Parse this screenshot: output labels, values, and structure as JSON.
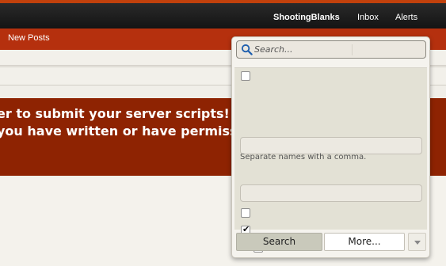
{
  "header": {
    "username": "ShootingBlanks",
    "inbox_label": "Inbox",
    "alerts_label": "Alerts"
  },
  "tabs": {
    "new_posts": "New Posts"
  },
  "banner": {
    "line1": "er to submit your server scripts! Make",
    "line2": "you have written or have permission"
  },
  "search_panel": {
    "search_placeholder": "Search...",
    "hint_text": "Separate names with a comma.",
    "search_button": "Search",
    "more_button": "More..."
  },
  "colors": {
    "accent": "#b5300e",
    "banner": "#8e2302",
    "topbar": "#1b1b1b"
  },
  "icons": {
    "search": "search-icon",
    "dropdown": "chevron-down-icon",
    "check": "check-icon"
  }
}
